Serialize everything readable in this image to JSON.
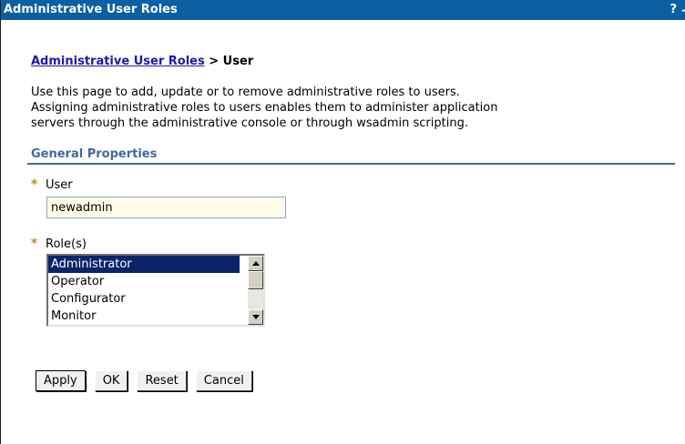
{
  "window": {
    "title": "Administrative User Roles",
    "help_label": "?",
    "more_label": "-"
  },
  "breadcrumb": {
    "link_label": "Administrative User Roles",
    "separator_and_current": " > User"
  },
  "description": "Use this page to add, update or to remove administrative roles to users.\nAssigning administrative roles to users enables them to administer application\nservers through the administrative console or through wsadmin scripting.",
  "section": {
    "title": "General Properties"
  },
  "form": {
    "required_marker": "*",
    "user_label": "User",
    "user_value": "newadmin",
    "roles_label": "Role(s)",
    "roles": [
      "Administrator",
      "Operator",
      "Configurator",
      "Monitor"
    ],
    "selected_role": "Administrator"
  },
  "buttons": {
    "apply": "Apply",
    "ok": "OK",
    "reset": "Reset",
    "cancel": "Cancel"
  },
  "colors": {
    "title_bar": "#0b5fa3",
    "section_title": "#3e6a9e",
    "link": "#1a1aa6",
    "selection": "#0a246a",
    "input_background": "#fffbe5"
  }
}
